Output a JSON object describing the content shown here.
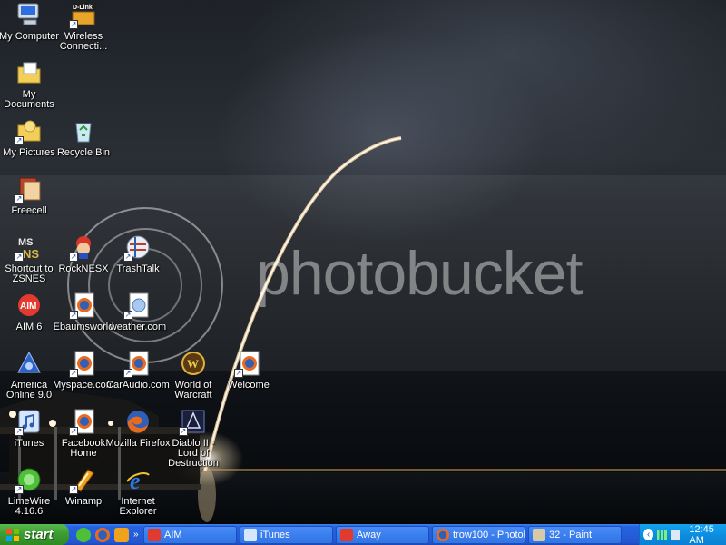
{
  "desktop": {
    "watermark": "photobucket",
    "icons": [
      {
        "label": "My Computer"
      },
      {
        "label": "Wireless Connecti..."
      },
      {
        "label": "My Documents"
      },
      {
        "label": "My Pictures"
      },
      {
        "label": "Recycle Bin"
      },
      {
        "label": "Freecell"
      },
      {
        "label": "Shortcut to ZSNES"
      },
      {
        "label": "RockNESX"
      },
      {
        "label": "TrashTalk"
      },
      {
        "label": "AIM 6"
      },
      {
        "label": "Ebaumsworld"
      },
      {
        "label": "weather.com"
      },
      {
        "label": "America Online 9.0"
      },
      {
        "label": "Myspace.com"
      },
      {
        "label": "CarAudio.com"
      },
      {
        "label": "World of Warcraft"
      },
      {
        "label": "Welcome"
      },
      {
        "label": "iTunes"
      },
      {
        "label": "Facebook Home"
      },
      {
        "label": "Mozilla Firefox"
      },
      {
        "label": "Diablo II - Lord of Destruction"
      },
      {
        "label": "LimeWire 4.16.6"
      },
      {
        "label": "Winamp"
      },
      {
        "label": "Internet Explorer"
      }
    ],
    "dlink_badge": "D-Link"
  },
  "taskbar": {
    "start_label": "start",
    "tasks": [
      {
        "label": "AIM",
        "icon": "aim-icon"
      },
      {
        "label": "iTunes",
        "icon": "itunes-icon"
      },
      {
        "label": "Away",
        "icon": "aim-away-icon"
      },
      {
        "label": "trow100 - Photob...",
        "icon": "firefox-icon"
      },
      {
        "label": "32 - Paint",
        "icon": "paint-icon"
      }
    ],
    "clock": "12:45 AM"
  }
}
